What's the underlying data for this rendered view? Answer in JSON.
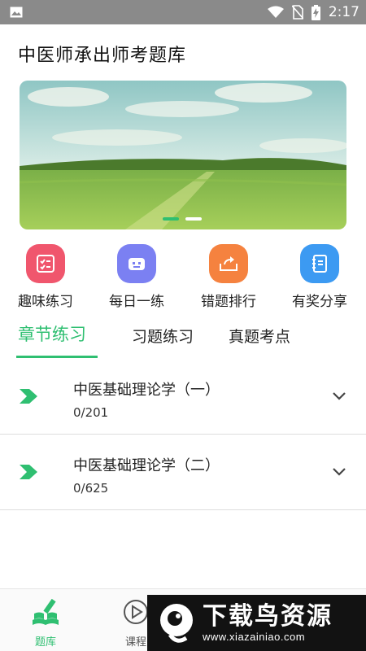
{
  "status_bar": {
    "time": "2:17",
    "icons": [
      "image-icon",
      "wifi-icon",
      "no-sim-icon",
      "battery-charging-icon"
    ]
  },
  "app": {
    "title": "中医师承出师考题库"
  },
  "banner": {
    "slide_count": 2,
    "active_slide": 1
  },
  "quick_actions": [
    {
      "label": "趣味练习",
      "icon": "checklist-icon",
      "color": "#f0566d"
    },
    {
      "label": "每日一练",
      "icon": "robot-icon",
      "color": "#7b80f2"
    },
    {
      "label": "错题排行",
      "icon": "inbox-share-icon",
      "color": "#f5823f"
    },
    {
      "label": "有奖分享",
      "icon": "notebook-icon",
      "color": "#3c9af2"
    }
  ],
  "tabs": [
    {
      "label": "章节练习",
      "active": true
    },
    {
      "label": "习题练习",
      "active": false
    },
    {
      "label": "真题考点",
      "active": false
    }
  ],
  "chapters": [
    {
      "title": "中医基础理论学（一）",
      "progress": "0/201"
    },
    {
      "title": "中医基础理论学（二）",
      "progress": "0/625"
    }
  ],
  "bottom_nav": [
    {
      "label": "题库",
      "icon": "book-pencil-icon",
      "active": true
    },
    {
      "label": "课程",
      "icon": "play-circle-icon",
      "active": false
    }
  ],
  "watermark": {
    "title": "下载鸟资源",
    "url": "www.xiazainiao.com"
  },
  "colors": {
    "accent": "#2fbf71",
    "status_bar": "#8a8a8a"
  }
}
